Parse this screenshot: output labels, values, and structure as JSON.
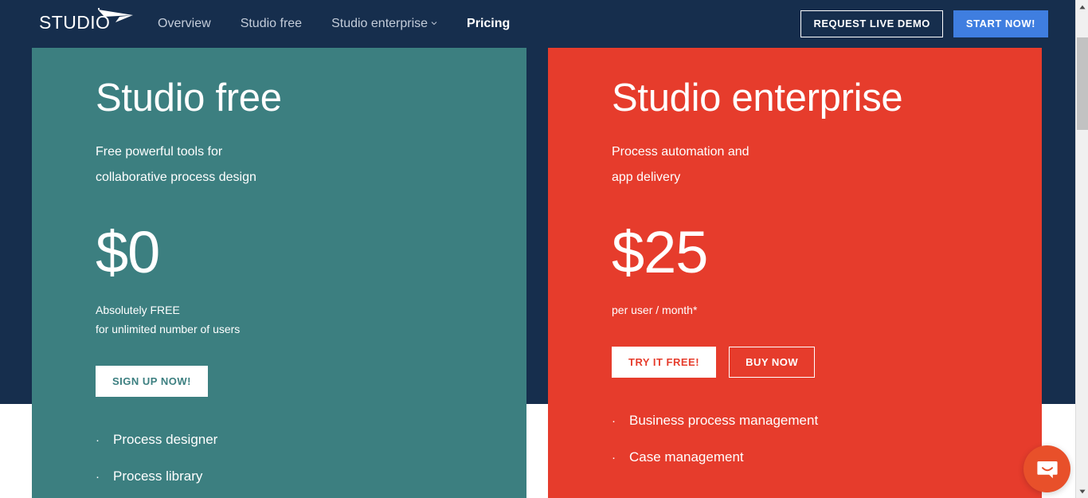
{
  "nav": {
    "logo_text": "STUDIO",
    "logo_icon": "paper-plane-arrow-icon",
    "links": [
      {
        "label": "Overview",
        "active": false,
        "has_caret": false
      },
      {
        "label": "Studio free",
        "active": false,
        "has_caret": false
      },
      {
        "label": "Studio enterprise",
        "active": false,
        "has_caret": true
      },
      {
        "label": "Pricing",
        "active": true,
        "has_caret": false
      }
    ],
    "demo_button": "REQUEST LIVE DEMO",
    "start_button": "START NOW!"
  },
  "colors": {
    "navy": "#162e4d",
    "teal": "#3c7f80",
    "red": "#e63c2c",
    "blue_button": "#3f7ee0",
    "chat_orange": "#e8502a"
  },
  "plans": {
    "free": {
      "title": "Studio free",
      "subtitle_line1": "Free powerful tools for",
      "subtitle_line2": "collaborative process design",
      "price": "$0",
      "note_line1": "Absolutely FREE",
      "note_line2": "for unlimited number of users",
      "buttons": [
        {
          "label": "SIGN UP NOW!",
          "style": "solid"
        }
      ],
      "features": [
        "Process designer",
        "Process library"
      ]
    },
    "enterprise": {
      "title": "Studio enterprise",
      "subtitle_line1": "Process automation and",
      "subtitle_line2": "app delivery",
      "price": "$25",
      "note_line1": "per user / month*",
      "note_line2": "",
      "buttons": [
        {
          "label": "TRY IT FREE!",
          "style": "solid"
        },
        {
          "label": "BUY NOW",
          "style": "outline"
        }
      ],
      "features": [
        "Business process management",
        "Case management"
      ]
    }
  },
  "bullet_glyph": "·",
  "chat": {
    "icon": "chat-smile-icon"
  },
  "scrollbar": {
    "up_icon": "scroll-up-arrow-icon",
    "down_icon": "scroll-down-arrow-icon"
  }
}
